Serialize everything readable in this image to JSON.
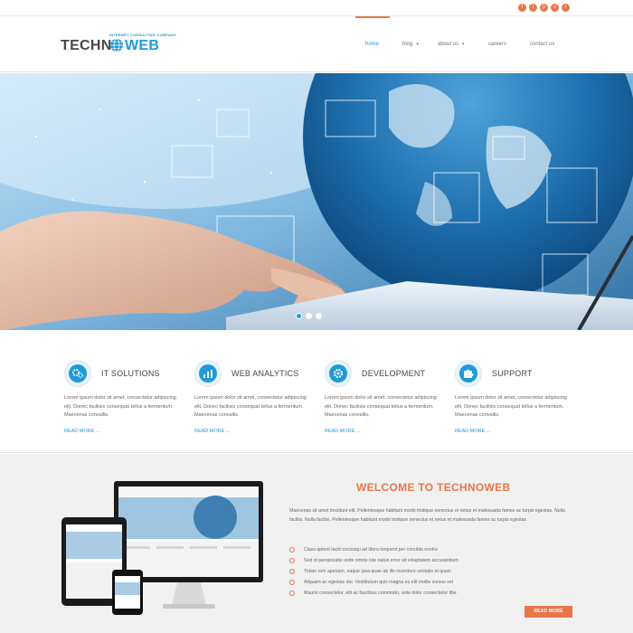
{
  "social": {
    "items": [
      {
        "icon": "facebook-icon",
        "glyph": "f"
      },
      {
        "icon": "twitter-icon",
        "glyph": "t"
      },
      {
        "icon": "pinterest-icon",
        "glyph": "p"
      },
      {
        "icon": "vimeo-icon",
        "glyph": "v"
      },
      {
        "icon": "rss-icon",
        "glyph": "r"
      }
    ]
  },
  "logo": {
    "tagline": "INTERNET CONSULTING COMPANY",
    "text_left": "TECHN",
    "text_right": "WEB"
  },
  "nav": {
    "home": "home",
    "blog": "blog",
    "about": "about us",
    "careers": "careers",
    "contact": "contact us"
  },
  "colors": {
    "accent": "#1f9ad8",
    "highlight": "#e9764a"
  },
  "hero": {
    "slides": 3,
    "active_slide": 1
  },
  "features": [
    {
      "icon": "gears-icon",
      "title": "IT SOLUTIONS",
      "text": "Lorem ipsum dolor sit amet, consectetur adipiscing elit. Donec facilisis consequat tellus a fermentum. Maecenas convallis.",
      "more": "READ MORE ..."
    },
    {
      "icon": "chart-icon",
      "title": "WEB ANALYTICS",
      "text": "Lorem ipsum dolor sit amet, consectetur adipiscing elit. Donec facilisis consequat tellus a fermentum. Maecenas convallis.",
      "more": "READ MORE ..."
    },
    {
      "icon": "cog-icon",
      "title": "DEVELOPMENT",
      "text": "Lorem ipsum dolor sit amet, consectetur adipiscing elit. Donec facilisis consequat tellus a fermentum. Maecenas convallis.",
      "more": "READ MORE ..."
    },
    {
      "icon": "puzzle-icon",
      "title": "SUPPORT",
      "text": "Lorem ipsum dolor sit amet, consectetur adipiscing elit. Donec facilisis consequat tellus a fermentum. Maecenas convallis.",
      "more": "READ MORE ..."
    }
  ],
  "welcome": {
    "title": "WELCOME TO TECHNOWEB",
    "paragraph": "Maecenas sit amet tincidunt elit. Pellentesque habitant morbi tristique senectus et netus et malesuada fames ac turpis egestas. Nulla facilisi. Nulla facilisi. Pellentesque habitant morbi tristique senectus et netus et malesuada fames ac turpis egestas",
    "checklist": [
      "Class aptent taciti sociosqu ad litora torquent per conubia nostra",
      "Sed ut perspiciatis unde omnis iste natus error sit voluptatem accusantium",
      "Totam rem aperiam, eaque ipsa quae ab illo inventore veritatis et quasi",
      "Aliquam ac egestas dui. Vestibulum quis magna eu elit mollis cursus vel",
      "Mauris consectetur, elit ac faucibus commodo, ante dolor consectetur libe"
    ],
    "button": "READ MORE"
  }
}
